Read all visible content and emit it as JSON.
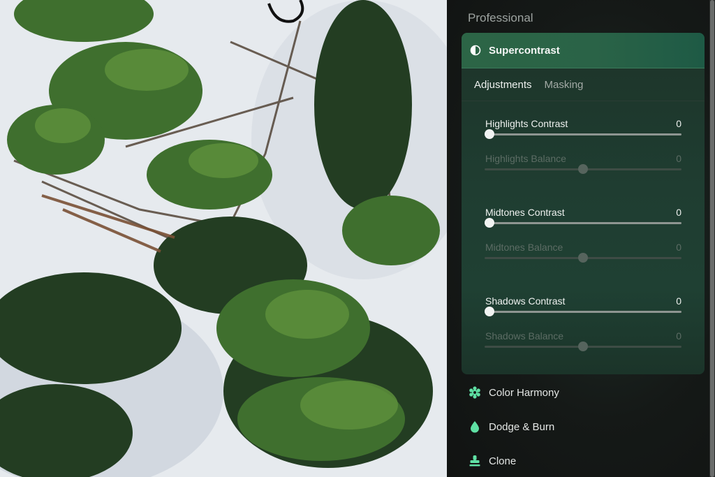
{
  "panel": {
    "section_title": "Professional",
    "module": {
      "title": "Supercontrast",
      "icon": "half-circle-contrast-icon",
      "tabs": [
        {
          "label": "Adjustments",
          "active": true
        },
        {
          "label": "Masking",
          "active": false
        }
      ],
      "sliders": [
        {
          "label": "Highlights Contrast",
          "value": "0",
          "enabled": true,
          "position": 0.0
        },
        {
          "label": "Highlights Balance",
          "value": "0",
          "enabled": false,
          "position": 0.5
        },
        {
          "label": "Midtones Contrast",
          "value": "0",
          "enabled": true,
          "position": 0.0
        },
        {
          "label": "Midtones Balance",
          "value": "0",
          "enabled": false,
          "position": 0.5
        },
        {
          "label": "Shadows Contrast",
          "value": "0",
          "enabled": true,
          "position": 0.0
        },
        {
          "label": "Shadows Balance",
          "value": "0",
          "enabled": false,
          "position": 0.5
        }
      ]
    },
    "tools": [
      {
        "label": "Color Harmony",
        "icon": "flower-gear-icon"
      },
      {
        "label": "Dodge & Burn",
        "icon": "drop-icon"
      },
      {
        "label": "Clone",
        "icon": "stamp-icon"
      }
    ]
  },
  "colors": {
    "accent_green": "#2c6546",
    "tool_icon_green": "#5fe0a4"
  }
}
